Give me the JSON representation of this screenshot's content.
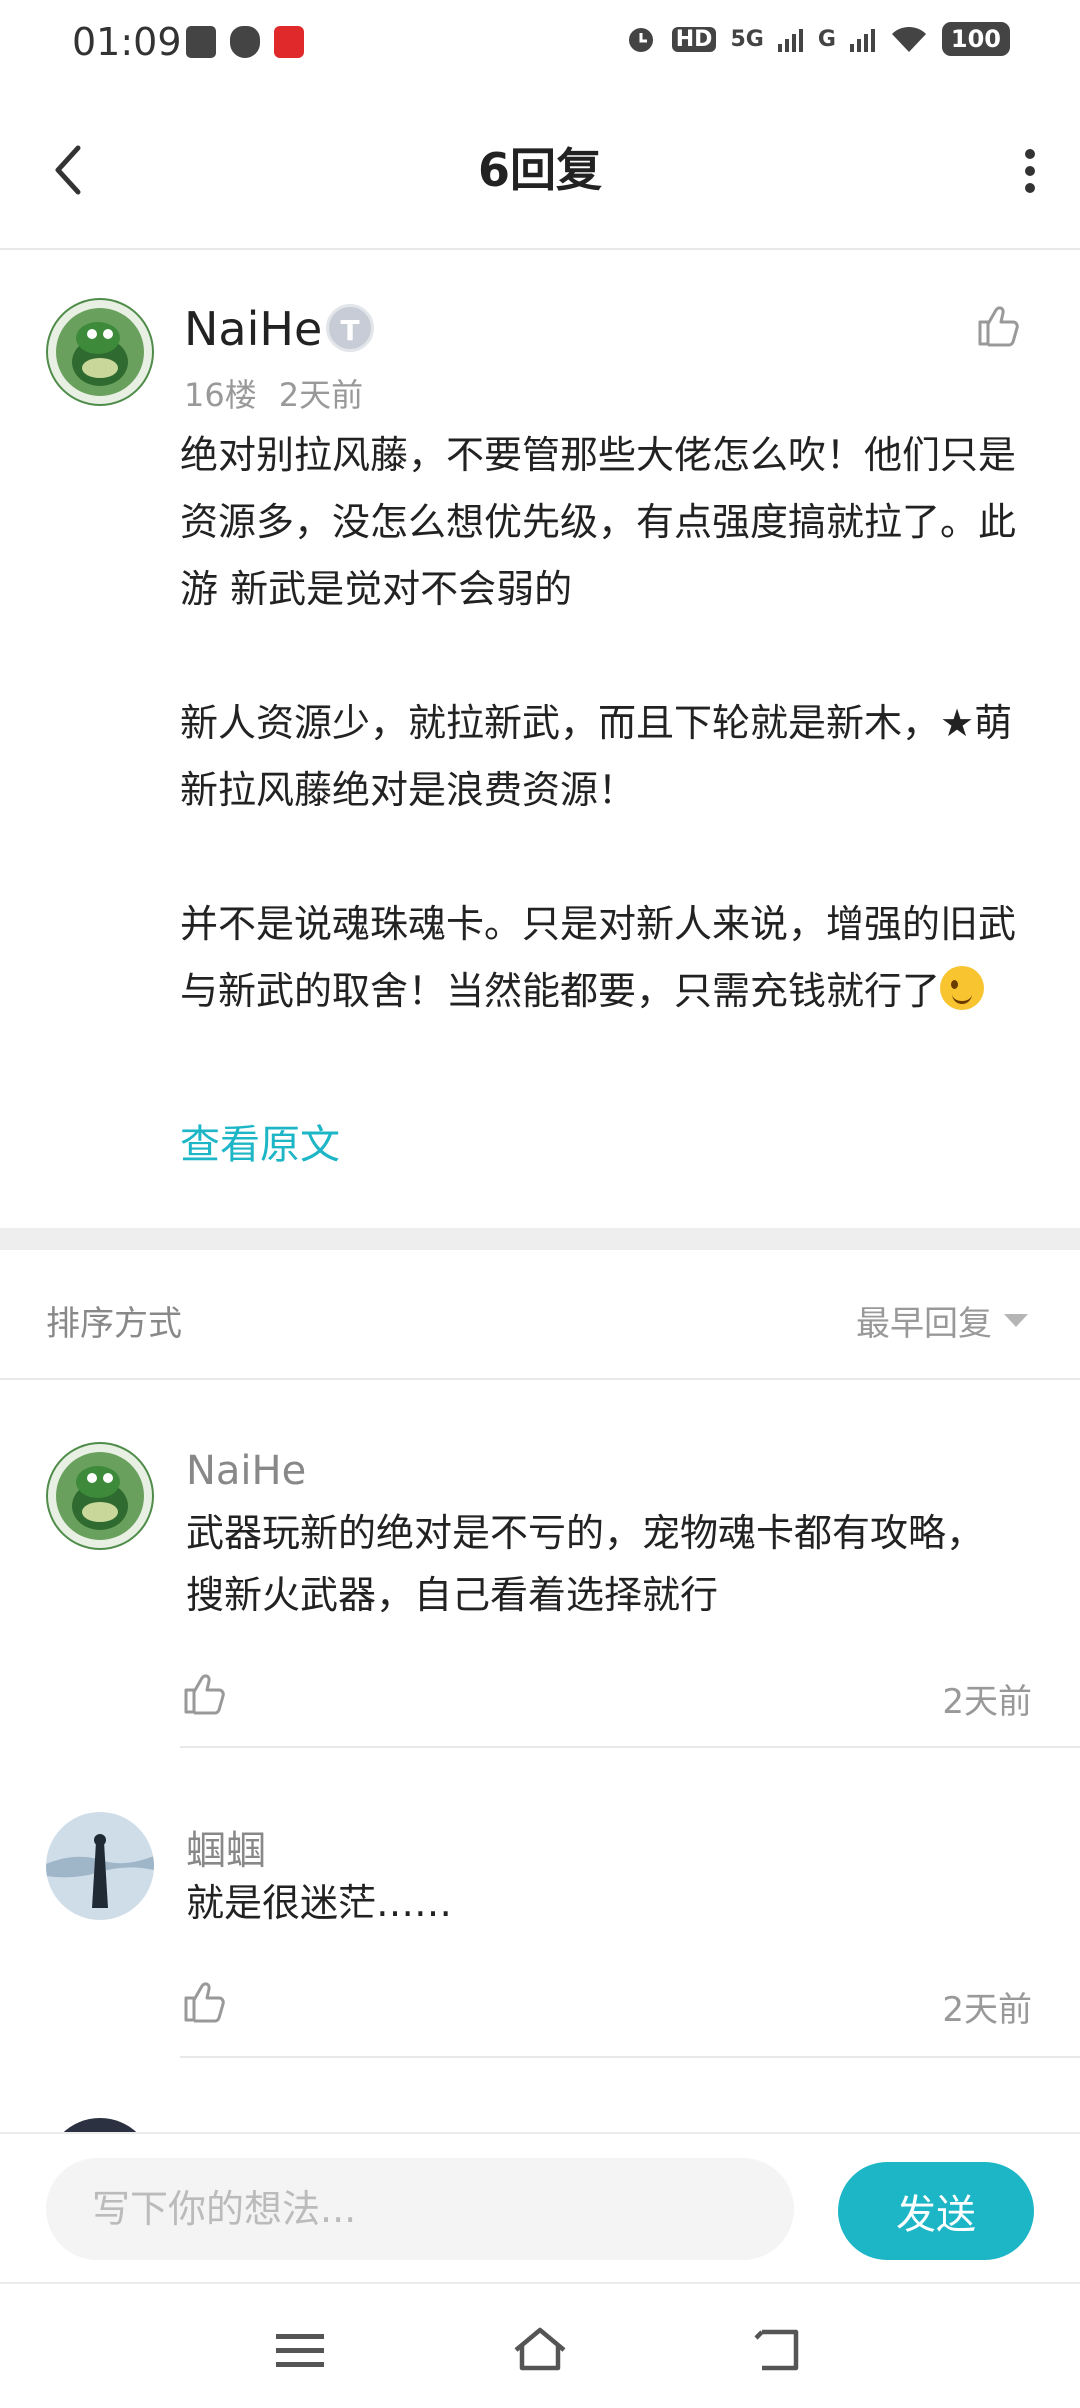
{
  "status_bar": {
    "time": "01:09",
    "hd_label": "HD",
    "sim1_label": "5G",
    "sim2_label": "G",
    "battery": "100"
  },
  "header": {
    "title": "6回复"
  },
  "post": {
    "author": "NaiHe",
    "level_badge": "T",
    "floor": "16楼",
    "time": "2天前",
    "paragraphs": [
      "绝对别拉风藤，不要管那些大佬怎么吹！他们只是资源多，没怎么想优先级，有点强度搞就拉了。此游 新武是觉对不会弱的",
      "",
      "新人资源少，就拉新武，而且下轮就是新木，★萌新拉风藤绝对是浪费资源！",
      "",
      "并不是说魂珠魂卡。只是对新人来说，增强的旧武与新武的取舍！当然能都要，只需充钱就行了"
    ],
    "view_original": "查看原文"
  },
  "sort": {
    "label": "排序方式",
    "value": "最早回复"
  },
  "replies": [
    {
      "name": "NaiHe",
      "text": "武器玩新的绝对是不亏的，宠物魂卡都有攻略，搜新火武器，自己看着选择就行",
      "time": "2天前"
    },
    {
      "name": "蝈蝈",
      "text": "就是很迷茫……",
      "time": "2天前"
    }
  ],
  "composer": {
    "placeholder": "写下你的想法...",
    "send_label": "发送"
  },
  "colors": {
    "accent": "#1db6c6"
  }
}
